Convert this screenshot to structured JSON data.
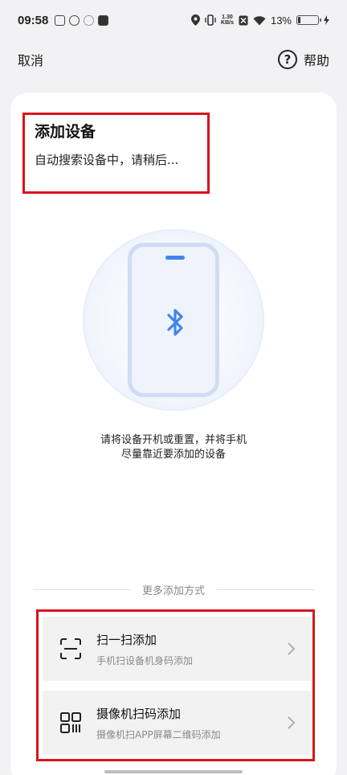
{
  "status_bar": {
    "time": "09:58",
    "net_speed_value": "1.30",
    "net_speed_unit": "KB/s",
    "battery_percent": "13%",
    "battery_level": 0.13,
    "left_icons": [
      "mail-icon",
      "leaf-icon",
      "snowflake-icon",
      "tiktok-icon"
    ],
    "right_icons": [
      "location-icon",
      "vibrate-icon",
      "x-icon",
      "wifi-icon",
      "battery-icon",
      "charging-icon"
    ]
  },
  "nav": {
    "cancel_label": "取消",
    "help_label": "帮助",
    "help_icon": "?"
  },
  "header": {
    "title": "添加设备",
    "subtitle": "自动搜索设备中，请稍后..."
  },
  "illustration": {
    "icon": "bluetooth-icon",
    "accent_color": "#3f86e8"
  },
  "instruction": {
    "line1": "请将设备开机或重置，并将手机",
    "line2": "尽量靠近要添加的设备"
  },
  "more_methods": {
    "divider_label": "更多添加方式",
    "options": [
      {
        "title": "扫一扫添加",
        "description": "手机扫设备机身码添加",
        "icon": "scan-icon"
      },
      {
        "title": "摄像机扫码添加",
        "description": "摄像机扫APP屏幕二维码添加",
        "icon": "qr-code-icon"
      }
    ]
  },
  "colors": {
    "highlight_border": "#d8141c",
    "background": "#f2f2f4",
    "card": "#ffffff"
  }
}
